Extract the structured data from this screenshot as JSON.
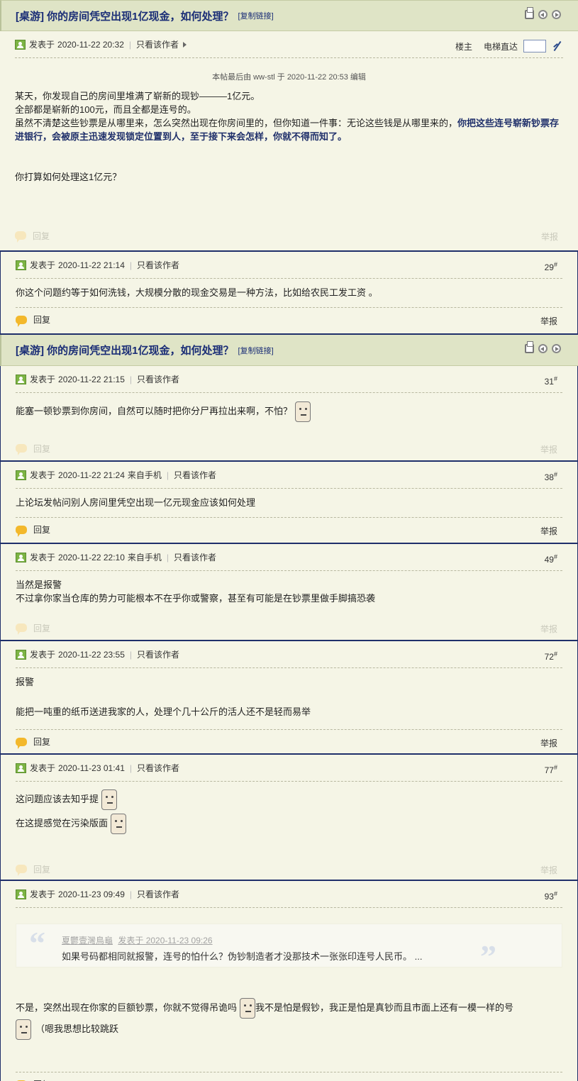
{
  "thread": {
    "prefix": "[桌游]",
    "title": "你的房间凭空出现1亿现金，如何处理？",
    "copy_link": "[复制链接]"
  },
  "common": {
    "posted_label": "发表于",
    "only_author": "只看该作者",
    "reply": "回复",
    "report": "举报",
    "floor_mark": "#"
  },
  "first_post": {
    "time": "2020-11-22 20:32",
    "owner": "楼主",
    "elevator": "电梯直达",
    "edit_note": "本帖最后由 ww-stl 于 2020-11-22 20:53 编辑",
    "line1": "某天，你发现自己的房间里堆满了崭新的现钞———1亿元。",
    "line2": "全部都是崭新的100元，而且全都是连号的。",
    "line3a": "虽然不清楚这些钞票是从哪里来，怎么突然出现在你房间里的，但你知道一件事：无论这些钱是从哪里来的，",
    "line3b": "你把这些连号崭新钞票存进银行，会被原主迅速发现锁定位置到人，至于接下来会怎样，你就不得而知了。",
    "line4": "你打算如何处理这1亿元？"
  },
  "posts": [
    {
      "time": "2020-11-22 21:14",
      "mobile": "",
      "floor": "29",
      "lines": [
        "你这个问题约等于如何洗钱，大规模分散的现金交易是一种方法，比如给农民工发工资 。"
      ]
    },
    {
      "time": "2020-11-22 21:15",
      "mobile": "",
      "floor": "31",
      "lines": [
        "能塞一顿钞票到你房间，自然可以随时把你分尸再拉出来啊，不怕？"
      ]
    },
    {
      "time": "2020-11-22 21:24",
      "mobile": "来自手机",
      "floor": "38",
      "lines": [
        "上论坛发帖问别人房间里凭空出现一亿元现金应该如何处理"
      ]
    },
    {
      "time": "2020-11-22 22:10",
      "mobile": "来自手机",
      "floor": "49",
      "lines": [
        "当然是报警",
        "不过拿你家当仓库的势力可能根本不在乎你或警察，甚至有可能是在钞票里做手脚搞恐袭"
      ]
    },
    {
      "time": "2020-11-22 23:55",
      "mobile": "",
      "floor": "72",
      "lines": [
        "报警",
        "能把一吨重的纸币送进我家的人，处理个几十公斤的活人还不是轻而易举"
      ]
    },
    {
      "time": "2020-11-23 01:41",
      "mobile": "",
      "floor": "77",
      "lines": [
        "这问题应该去知乎提",
        "在这提感觉在污染版面"
      ]
    },
    {
      "time": "2020-11-23 09:49",
      "mobile": "",
      "floor": "93",
      "quote_author": "夏鬱壹灣鳥龜",
      "quote_posted": "发表于 2020-11-23 09:26",
      "quote_text": "如果号码都相同就报警，连号的怕什么？伪钞制造者才没那技术一张张印连号人民币。 ...",
      "lines": [
        "不是，突然出现在你家的巨额钞票，你就不觉得吊诡吗",
        "我不是怕是假钞，我正是怕是真钞而且市面上还有一模一样的号",
        "（嗯我思想比较跳跃"
      ]
    }
  ]
}
